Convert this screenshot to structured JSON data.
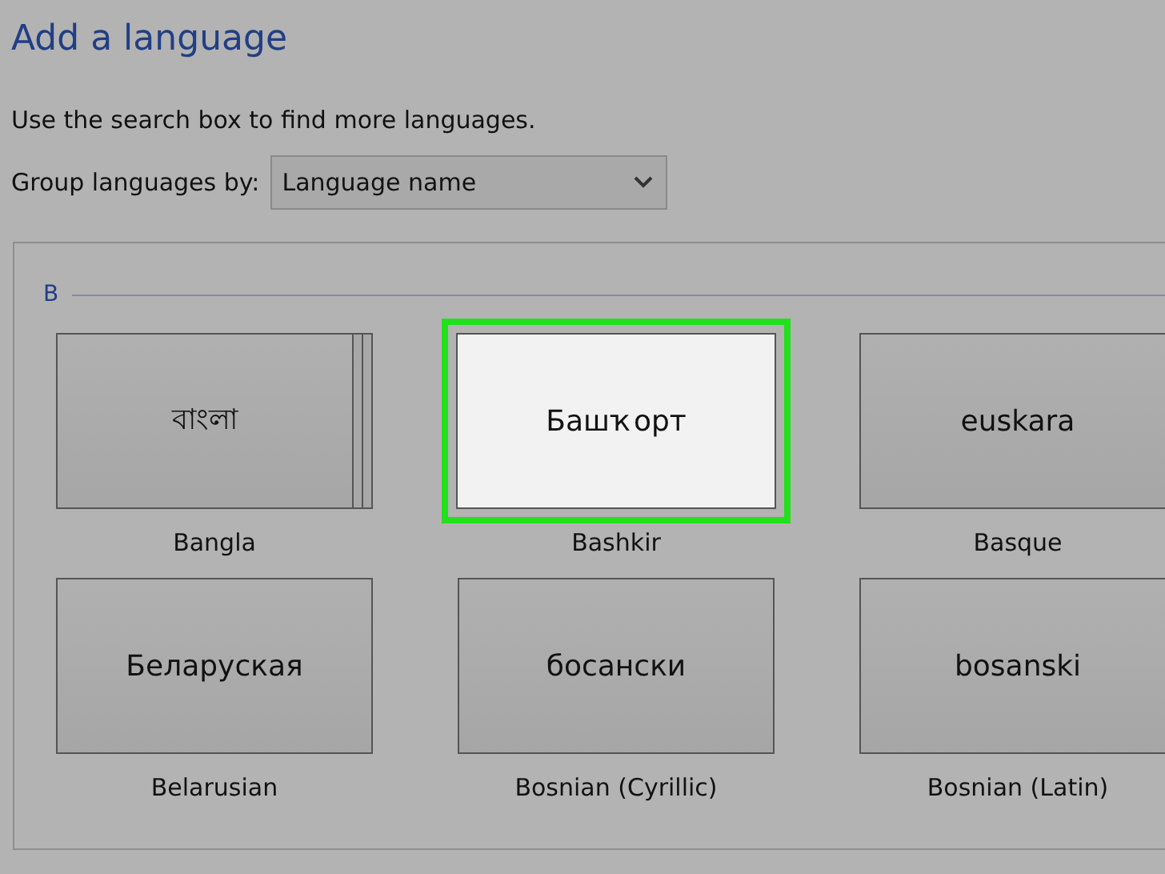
{
  "title": "Add a language",
  "hint": "Use the search box to find more languages.",
  "group_by": {
    "label": "Group languages by:",
    "value": "Language name"
  },
  "groups": [
    {
      "heading": "B",
      "languages": [
        {
          "native": "বাংলা",
          "name": "Bangla",
          "selected": false,
          "kind": "stacked"
        },
        {
          "native": "Башҡорт",
          "name": "Bashkir",
          "selected": true,
          "kind": "single"
        },
        {
          "native": "euskara",
          "name": "Basque",
          "selected": false,
          "kind": "single"
        },
        {
          "native": "Беларуская",
          "name": "Belarusian",
          "selected": false,
          "kind": "single"
        },
        {
          "native": "босански",
          "name": "Bosnian (Cyrillic)",
          "selected": false,
          "kind": "single"
        },
        {
          "native": "bosanski",
          "name": "Bosnian (Latin)",
          "selected": false,
          "kind": "single"
        }
      ]
    }
  ]
}
